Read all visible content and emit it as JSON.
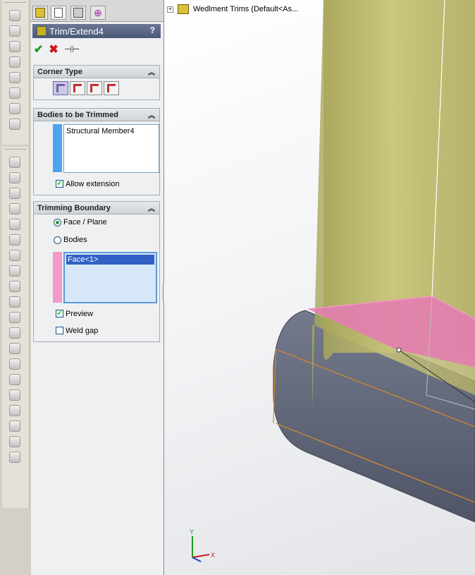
{
  "feature_tree": {
    "item": "Wedlment Trims  (Default<As..."
  },
  "property_manager": {
    "title": "Trim/Extend4",
    "help": "?",
    "corner_type": {
      "header": "Corner Type"
    },
    "bodies": {
      "header": "Bodies to be Trimmed",
      "items": [
        "Structural Member4"
      ],
      "allow_extension": "Allow extension",
      "allow_extension_checked": true
    },
    "boundary": {
      "header": "Trimming Boundary",
      "option_face": "Face / Plane",
      "option_bodies": "Bodies",
      "selected_option": "face",
      "items": [
        "Face<1>"
      ],
      "preview": "Preview",
      "preview_checked": true,
      "weld_gap": "Weld gap",
      "weld_gap_checked": false
    }
  },
  "triad": {
    "y": "Y",
    "x": "X"
  },
  "colors": {
    "body_color": "#4da3ef",
    "boundary_color": "#f29ac9",
    "trim_highlight": "#e67ab4",
    "tube_color": "#c6c270"
  }
}
